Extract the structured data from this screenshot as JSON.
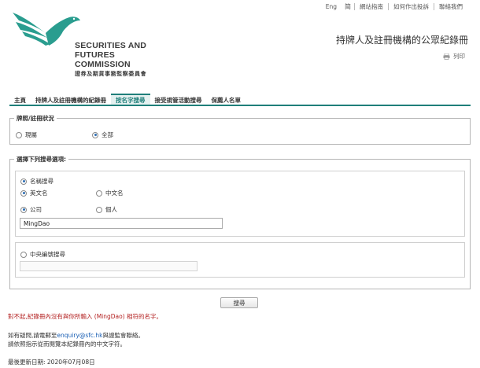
{
  "top_links": {
    "lang_en": "Eng",
    "lang_zh": "简",
    "sitemap": "網站指南",
    "complaint": "如何作出投訴",
    "contact": "聯絡我們"
  },
  "logo": {
    "en": "SECURITIES AND\nFUTURES COMMISSION",
    "zh": "證券及期貨事務監察委員會",
    "color": "#2a9d8f"
  },
  "page_title": "持牌人及註冊機構的公眾紀錄冊",
  "print_label": "列印",
  "tabs": [
    {
      "label": "主頁",
      "active": false
    },
    {
      "label": "持牌人及註冊機構的紀錄冊",
      "active": false
    },
    {
      "label": "按名字搜尋",
      "active": true
    },
    {
      "label": "接受規管活動搜尋",
      "active": false
    },
    {
      "label": "保薦人名單",
      "active": false
    }
  ],
  "status_section": {
    "legend": "牌照/註冊狀況",
    "options": [
      {
        "label": "現屬",
        "selected": false
      },
      {
        "label": "全部",
        "selected": true
      }
    ]
  },
  "search_section": {
    "legend": "選擇下列搜尋選項:",
    "name_search": {
      "label": "名稱搜尋",
      "selected": true
    },
    "name_lang": [
      {
        "label": "英文名",
        "selected": true
      },
      {
        "label": "中文名",
        "selected": false
      }
    ],
    "entity_type": [
      {
        "label": "公司",
        "selected": true
      },
      {
        "label": "個人",
        "selected": false
      }
    ],
    "name_value": "MingDao",
    "ce_search": {
      "label": "中央編號搜尋",
      "selected": false
    },
    "ce_value": ""
  },
  "search_button": "搜尋",
  "error_message": "對不起,紀錄冊內沒有與你所輸入 (MingDao) 相符的名字。",
  "help": {
    "line1_prefix": "如有疑問,請電郵至",
    "email": "enquiry@sfc.hk",
    "line1_suffix": "與證監會聯絡。",
    "line2": "請依照指示從而閱覽本紀錄冊內的中文字符。"
  },
  "last_updated": "最後更新日期: 2020年07月08日",
  "colors": {
    "accent": "#1f7f7a",
    "error": "#b32020",
    "link": "#1a5fb4"
  }
}
